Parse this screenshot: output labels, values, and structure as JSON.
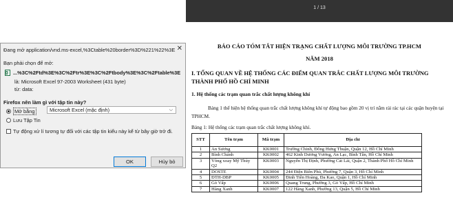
{
  "dialog": {
    "title": "Đang mở application/vnd.ms-excel,%3Ctable%20border%3D%221%22%3E...",
    "close_glyph": "✕",
    "prompt": "Bạn phải chọn để mở:",
    "file_icon": "excel-file-icon",
    "file_name": "...%3C%2Ftd%3E%3C%2Ftr%3E%3C%2Ftbody%3E%3C%2Ftable%3E",
    "type_line": "là:  Microsoft Excel 97-2003 Worksheet (431 byte)",
    "from_line": "từ:  data:",
    "question": "Firefox nên làm gì với tập tin này?",
    "open_with_label": "Mở bằng",
    "open_with_value": "Microsoft Excel (mặc định)",
    "save_label": "Lưu Tập Tin",
    "auto_label": "Tự động xử lí tương tự đối với các tập tin kiểu này kể từ bây giờ trở đi.",
    "ok_label": "OK",
    "cancel_label": "Hủy bỏ"
  },
  "viewer": {
    "page_indicator": "1 / 13",
    "title_line1": "BÁO CÁO TÓM TẮT HIỆN TRẠNG CHẤT LƯỢNG MÔI TRƯỜNG TP.HCM",
    "title_line2": "NĂM 2018",
    "section1": "I. TỔNG QUAN VỀ HỆ THỐNG CÁC ĐIỂM QUAN TRẮC CHẤT LƯỢNG MÔI TRƯỜNG THÀNH PHỐ HỒ CHÍ MINH",
    "subsection1": "1. Hệ thống các trạm quan trắc chất lượng không khí",
    "paragraph": "Bảng 1 thể hiện hệ thống quan trắc chất lượng không khí tự động bao gồm 20 vị trí nằm rải rác tại các quận huyện tại TPHCM.",
    "table_caption": "Bảng 1: Hệ thống các trạm quan trắc chất lượng không khí.",
    "table": {
      "headers": [
        "STT",
        "Tên trạm",
        "Mã trạm",
        "Địa chỉ"
      ],
      "rows": [
        [
          "1",
          "An Sương",
          "KK0001",
          "Trường Chinh, Đông Hưng Thuận, Quận 12, Hồ Chí Minh"
        ],
        [
          "2",
          "Bình Chánh",
          "KK0002",
          "462 Kinh Dương Vương, An Lạc, Bình Tân, Hồ Chí Minh"
        ],
        [
          "3",
          "Vòng xoay Mỹ Thủy Q2",
          "KK0003",
          "Nguyễn Thị Định, Phường Cát Lái, Quận 2, Thành Phố Hồ Chí Minh"
        ],
        [
          "4",
          "DOSTE",
          "KK0004",
          "244 Điện Biên Phủ, Phường 7, Quận 3, Hồ Chí Minh"
        ],
        [
          "5",
          "ĐTH-DBP",
          "KK0005",
          "Đinh Tiên Hoàng, Đa Kao, Quận 1, Hồ Chí Minh"
        ],
        [
          "6",
          "Gò Vấp",
          "KK0006",
          "Quang Trung, Phường 3, Gò Vấp, Hồ Chí Minh"
        ],
        [
          "7",
          "Hàng Xanh",
          "KK0007",
          "122 Hàng Xanh, Phường 13, Quận 5, Hồ Chí Minh"
        ]
      ]
    }
  }
}
